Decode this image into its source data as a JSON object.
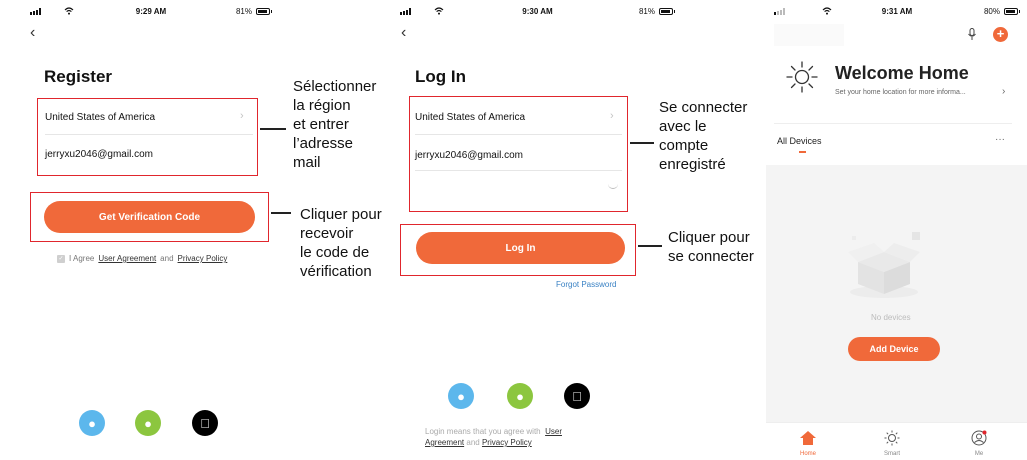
{
  "screen1": {
    "status": {
      "time": "9:29 AM",
      "battery": "81%"
    },
    "title": "Register",
    "region": "United States of America",
    "email": "jerryxu2046@gmail.com",
    "button": "Get Verification Code",
    "agree_prefix": "I Agree",
    "user_agreement": "User Agreement",
    "and": "and",
    "privacy_policy": "Privacy Policy"
  },
  "screen2": {
    "status": {
      "time": "9:30 AM",
      "battery": "81%"
    },
    "title": "Log In",
    "region": "United States of America",
    "email": "jerryxu2046@gmail.com",
    "button": "Log In",
    "forgot": "Forgot Password",
    "legal_prefix": "Login means that you agree with",
    "user_agreement_a": "User",
    "user_agreement_b": "Agreement",
    "and": "and",
    "privacy_policy": "Privacy Policy"
  },
  "screen3": {
    "status": {
      "time": "9:31 AM",
      "battery": "80%"
    },
    "welcome": "Welcome Home",
    "subtitle": "Set your home location for more informa...",
    "all_devices": "All Devices",
    "more": "···",
    "no_devices": "No devices",
    "add_device": "Add Device",
    "tabs": [
      {
        "label": "Home"
      },
      {
        "label": "Smart"
      },
      {
        "label": "Me"
      }
    ]
  },
  "annotations": {
    "a1": [
      "Sélectionner",
      "la région",
      "et entrer",
      "l’adresse",
      "mail"
    ],
    "a2": [
      "Cliquer pour",
      "recevoir",
      "le code de",
      "vérification"
    ],
    "a3": [
      "Se connecter",
      "avec le",
      "compte",
      "enregistré"
    ],
    "a4": [
      "Cliquer pour",
      "se connecter"
    ]
  },
  "colors": {
    "accent": "#f0693a",
    "annotation_box": "#e0262d",
    "link": "#3a82c4"
  }
}
